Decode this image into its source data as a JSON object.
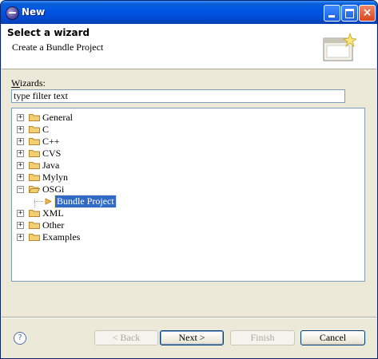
{
  "window": {
    "title": "New"
  },
  "header": {
    "title": "Select a wizard",
    "description": "Create a Bundle Project"
  },
  "filter": {
    "label_mnemonic": "W",
    "label_rest": "izards:",
    "value": "type filter text"
  },
  "tree": {
    "nodes": [
      {
        "label": "General",
        "expander": "+"
      },
      {
        "label": "C",
        "expander": "+"
      },
      {
        "label": "C++",
        "expander": "+"
      },
      {
        "label": "CVS",
        "expander": "+"
      },
      {
        "label": "Java",
        "expander": "+"
      },
      {
        "label": "Mylyn",
        "expander": "+"
      },
      {
        "label": "OSGi",
        "expander": "−"
      },
      {
        "label": "XML",
        "expander": "+"
      },
      {
        "label": "Other",
        "expander": "+"
      },
      {
        "label": "Examples",
        "expander": "+"
      }
    ],
    "selected_child": "Bundle Project"
  },
  "buttons": {
    "help": "?",
    "back": "< Back",
    "next": "Next >",
    "finish": "Finish",
    "cancel": "Cancel"
  },
  "colors": {
    "selection": "#316ac5",
    "folder": "#e9c36a",
    "titlebar": "#0055e5"
  }
}
